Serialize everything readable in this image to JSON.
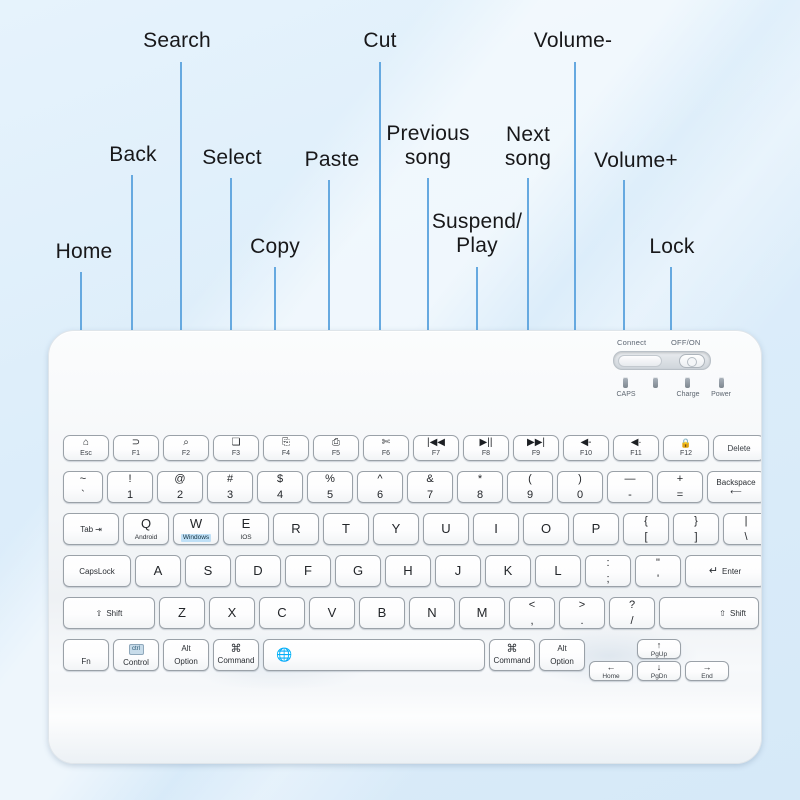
{
  "theme": {
    "background": "#dceefb",
    "callout_line": "#66a9e0",
    "label_color": "#18181a",
    "accent_highlight": "#bfe0f7"
  },
  "callouts": [
    {
      "text": "Home",
      "key": "Esc"
    },
    {
      "text": "Back",
      "key": "F1"
    },
    {
      "text": "Search",
      "key": "F2"
    },
    {
      "text": "Select",
      "key": "F3"
    },
    {
      "text": "Copy",
      "key": "F4"
    },
    {
      "text": "Paste",
      "key": "F5"
    },
    {
      "text": "Cut",
      "key": "F6"
    },
    {
      "text": "Previous\nsong",
      "key": "F7"
    },
    {
      "text": "Suspend/\nPlay",
      "key": "F8"
    },
    {
      "text": "Next\nsong",
      "key": "F9"
    },
    {
      "text": "Volume-",
      "key": "F10"
    },
    {
      "text": "Volume+",
      "key": "F11"
    },
    {
      "text": "Lock",
      "key": "F12"
    }
  ],
  "status_panel": {
    "connect_label": "Connect",
    "power_label": "OFF/ON",
    "leds": [
      {
        "label": "CAPS"
      },
      {
        "label": ""
      },
      {
        "label": "Charge"
      },
      {
        "label": "Power"
      }
    ]
  },
  "rows": {
    "function": [
      {
        "glyph": "⌂",
        "sub": "Esc"
      },
      {
        "glyph": "⊃",
        "sub": "F1"
      },
      {
        "glyph": "⌕",
        "sub": "F2"
      },
      {
        "glyph": "❏",
        "sub": "F3"
      },
      {
        "glyph": "⎘",
        "sub": "F4"
      },
      {
        "glyph": "⎙",
        "sub": "F5"
      },
      {
        "glyph": "✄",
        "sub": "F6"
      },
      {
        "glyph": "|◀◀",
        "sub": "F7"
      },
      {
        "glyph": "▶||",
        "sub": "F8"
      },
      {
        "glyph": "▶▶|",
        "sub": "F9"
      },
      {
        "glyph": "◀-",
        "sub": "F10"
      },
      {
        "glyph": "◀∙",
        "sub": "F11"
      },
      {
        "glyph": "🔒",
        "sub": "F12"
      },
      {
        "glyph": "",
        "sub": "Delete"
      }
    ],
    "numbers": [
      {
        "top": "~",
        "bot": "`"
      },
      {
        "top": "!",
        "bot": "1"
      },
      {
        "top": "@",
        "bot": "2"
      },
      {
        "top": "#",
        "bot": "3"
      },
      {
        "top": "$",
        "bot": "4"
      },
      {
        "top": "%",
        "bot": "5"
      },
      {
        "top": "^",
        "bot": "6"
      },
      {
        "top": "&",
        "bot": "7"
      },
      {
        "top": "*",
        "bot": "8"
      },
      {
        "top": "(",
        "bot": "9"
      },
      {
        "top": ")",
        "bot": "0"
      },
      {
        "top": "—",
        "bot": "-"
      },
      {
        "top": "+",
        "bot": "="
      }
    ],
    "backspace": {
      "label": "Backspace",
      "arrow": "⟵"
    },
    "tab": {
      "label": "Tab",
      "arrow": "⇥"
    },
    "qwerty": [
      {
        "main": "Q",
        "os": "Android",
        "hl": false
      },
      {
        "main": "W",
        "os": "Windows",
        "hl": true
      },
      {
        "main": "E",
        "os": "IOS",
        "hl": false
      },
      {
        "main": "R",
        "os": ""
      },
      {
        "main": "T",
        "os": ""
      },
      {
        "main": "Y",
        "os": ""
      },
      {
        "main": "U",
        "os": ""
      },
      {
        "main": "I",
        "os": ""
      },
      {
        "main": "O",
        "os": ""
      },
      {
        "main": "P",
        "os": ""
      },
      {
        "top": "{",
        "bot": "["
      },
      {
        "top": "}",
        "bot": "]"
      },
      {
        "top": "|",
        "bot": "\\"
      }
    ],
    "capslock": "CapsLock",
    "asdf": [
      {
        "main": "A"
      },
      {
        "main": "S"
      },
      {
        "main": "D"
      },
      {
        "main": "F"
      },
      {
        "main": "G"
      },
      {
        "main": "H"
      },
      {
        "main": "J"
      },
      {
        "main": "K"
      },
      {
        "main": "L"
      },
      {
        "top": ":",
        "bot": ";"
      },
      {
        "top": "\"",
        "bot": "'"
      }
    ],
    "enter": {
      "label": "Enter",
      "arrow": "↵"
    },
    "shift_left": {
      "label": "Shift",
      "arrow": "⇧"
    },
    "zxcv": [
      {
        "main": "Z"
      },
      {
        "main": "X"
      },
      {
        "main": "C"
      },
      {
        "main": "V"
      },
      {
        "main": "B"
      },
      {
        "main": "N"
      },
      {
        "main": "M"
      },
      {
        "top": "<",
        "bot": ","
      },
      {
        "top": ">",
        "bot": "."
      },
      {
        "top": "?",
        "bot": "/"
      }
    ],
    "shift_right": {
      "label": "Shift",
      "arrow": "⇧"
    },
    "bottom_left": [
      {
        "main": "Fn",
        "top": ""
      },
      {
        "main": "Control",
        "top": "ctrl"
      },
      {
        "main": "Option",
        "top": "Alt"
      },
      {
        "main": "Command",
        "top": "⌘"
      }
    ],
    "space": {
      "icon": "🌐"
    },
    "bottom_right": [
      {
        "main": "Command",
        "top": "⌘"
      },
      {
        "main": "Option",
        "top": "Alt"
      }
    ],
    "nav": {
      "home": {
        "arrow": "←",
        "label": "Home"
      },
      "pgup": {
        "arrow": "↑",
        "label": "PgUp"
      },
      "pgdn": {
        "arrow": "↓",
        "label": "PgDn"
      },
      "end": {
        "arrow": "→",
        "label": "End"
      }
    }
  }
}
